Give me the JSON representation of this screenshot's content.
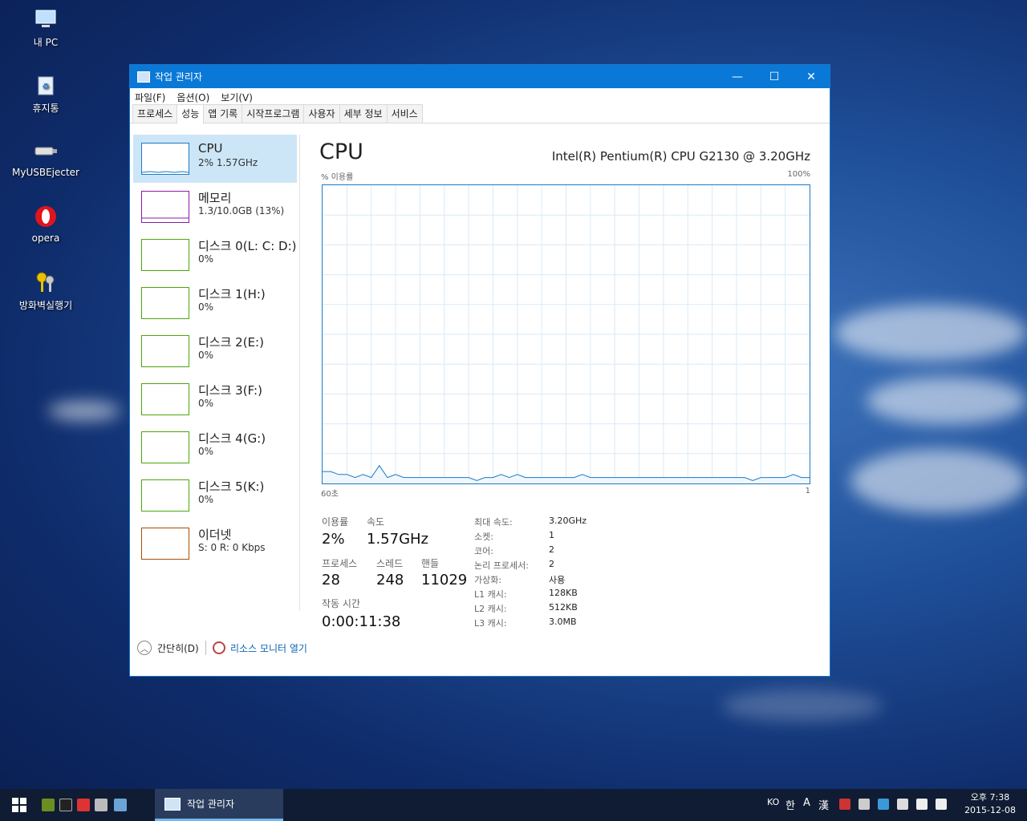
{
  "desktop": {
    "icons": [
      {
        "label": "내 PC",
        "icon": "computer-icon"
      },
      {
        "label": "휴지통",
        "icon": "recycle-bin-icon"
      },
      {
        "label": "MyUSBEjecter",
        "icon": "usb-icon"
      },
      {
        "label": "opera",
        "icon": "opera-icon"
      },
      {
        "label": "방화벽실행기",
        "icon": "keys-icon"
      }
    ]
  },
  "window": {
    "title": "작업 관리자",
    "menu": [
      "파일(F)",
      "옵션(O)",
      "보기(V)"
    ],
    "tabs": [
      "프로세스",
      "성능",
      "앱 기록",
      "시작프로그램",
      "사용자",
      "세부 정보",
      "서비스"
    ],
    "active_tab": "성능"
  },
  "sidebar": {
    "items": [
      {
        "name": "CPU",
        "sub": "2% 1.57GHz",
        "color": "#1a7bc5"
      },
      {
        "name": "메모리",
        "sub": "1.3/10.0GB (13%)",
        "color": "#8b1aa8"
      },
      {
        "name": "디스크 0(L: C: D:)",
        "sub": "0%",
        "color": "#4da60c"
      },
      {
        "name": "디스크 1(H:)",
        "sub": "0%",
        "color": "#4da60c"
      },
      {
        "name": "디스크 2(E:)",
        "sub": "0%",
        "color": "#4da60c"
      },
      {
        "name": "디스크 3(F:)",
        "sub": "0%",
        "color": "#4da60c"
      },
      {
        "name": "디스크 4(G:)",
        "sub": "0%",
        "color": "#4da60c"
      },
      {
        "name": "디스크 5(K:)",
        "sub": "0%",
        "color": "#4da60c"
      },
      {
        "name": "이더넷",
        "sub": "S: 0 R: 0 Kbps",
        "color": "#a74f01"
      }
    ]
  },
  "cpu": {
    "title": "CPU",
    "model": "Intel(R) Pentium(R) CPU G2130 @ 3.20GHz",
    "graph_label_left": "% 이용률",
    "graph_label_right": "100%",
    "time_left": "60초",
    "time_right": "1",
    "utilization_label": "이용률",
    "utilization": "2%",
    "speed_label": "속도",
    "speed": "1.57GHz",
    "processes_label": "프로세스",
    "processes": "28",
    "threads_label": "스레드",
    "threads": "248",
    "handles_label": "핸들",
    "handles": "11029",
    "uptime_label": "작동 시간",
    "uptime": "0:00:11:38",
    "specs": [
      {
        "label": "최대 속도:",
        "value": "3.20GHz"
      },
      {
        "label": "소켓:",
        "value": "1"
      },
      {
        "label": "코어:",
        "value": "2"
      },
      {
        "label": "논리 프로세서:",
        "value": "2"
      },
      {
        "label": "가상화:",
        "value": "사용"
      },
      {
        "label": "L1 캐시:",
        "value": "128KB"
      },
      {
        "label": "L2 캐시:",
        "value": "512KB"
      },
      {
        "label": "L3 캐시:",
        "value": "3.0MB"
      }
    ],
    "usage_history": [
      4,
      4,
      3,
      3,
      2,
      3,
      2,
      6,
      2,
      3,
      2,
      2,
      2,
      2,
      2,
      2,
      2,
      2,
      2,
      1,
      2,
      2,
      3,
      2,
      3,
      2,
      2,
      2,
      2,
      2,
      2,
      2,
      3,
      2,
      2,
      2,
      2,
      2,
      2,
      2,
      2,
      2,
      2,
      2,
      2,
      2,
      2,
      2,
      2,
      2,
      2,
      2,
      2,
      1,
      2,
      2,
      2,
      2,
      3,
      2,
      2
    ]
  },
  "footer": {
    "simple_label": "간단히(D)",
    "resource_monitor_label": "리소스 모니터 열기"
  },
  "taskbar": {
    "app_label": "작업 관리자",
    "lang": "KO",
    "ime_mode": "한",
    "ime_a": "A",
    "ime_hanja": "漢",
    "time": "오후 7:38",
    "date": "2015-12-08"
  }
}
